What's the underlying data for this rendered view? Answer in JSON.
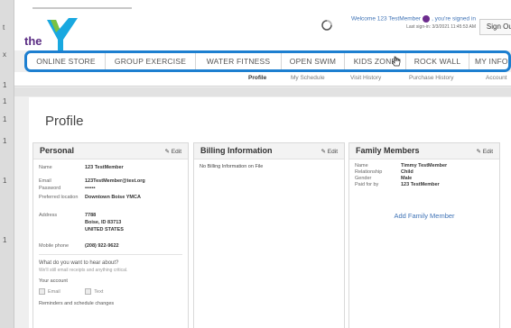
{
  "header": {
    "logo_text": "the",
    "welcome_text": "Welcome 123 TestMember",
    "welcome_suffix": ", you're signed in",
    "last_signin": "Last sign-in: 3/3/2021 11:45:53 AM",
    "sign_out": "Sign Out"
  },
  "nav": {
    "items": [
      {
        "label": "ONLINE STORE"
      },
      {
        "label": "GROUP EXERCISE"
      },
      {
        "label": "WATER FITNESS"
      },
      {
        "label": "OPEN SWIM"
      },
      {
        "label": "KIDS ZONE"
      },
      {
        "label": "ROCK WALL"
      },
      {
        "label": "MY INFO"
      }
    ]
  },
  "subnav": {
    "items": [
      {
        "label": "Profile"
      },
      {
        "label": "My Schedule"
      },
      {
        "label": "Visit History"
      },
      {
        "label": "Purchase History"
      },
      {
        "label": "Account"
      }
    ]
  },
  "page": {
    "title": "Profile"
  },
  "personal": {
    "title": "Personal",
    "edit": "Edit",
    "fields": [
      {
        "label": "Name",
        "value": "123 TestMember"
      },
      {
        "label": "Email",
        "value": "123TestMember@test.org"
      },
      {
        "label": "Password",
        "value": "••••••"
      },
      {
        "label": "Preferred location",
        "value": "Downtown Boise YMCA"
      },
      {
        "label": "Address",
        "value": "7788"
      },
      {
        "label": "",
        "value": "Boise, ID 83713"
      },
      {
        "label": "",
        "value": "UNITED STATES"
      },
      {
        "label": "Mobile phone",
        "value": "(208) 922-9622"
      }
    ],
    "question": "What do you want to hear about?",
    "question_note": "We'll still email receipts and anything critical.",
    "your_account": "Your account",
    "opt_email": "Email",
    "opt_text": "Text",
    "reminders": "Reminders and schedule changes"
  },
  "billing": {
    "title": "Billing Information",
    "edit": "Edit",
    "empty": "No Billing Information on File"
  },
  "family": {
    "title": "Family Members",
    "edit": "Edit",
    "fields": [
      {
        "label": "Name",
        "value": "Timmy TestMember"
      },
      {
        "label": "Relationship",
        "value": "Child"
      },
      {
        "label": "Gender",
        "value": "Male"
      },
      {
        "label": "Paid for by",
        "value": "123 TestMember"
      }
    ],
    "add": "Add Family Member"
  },
  "left_strip": {
    "marks": [
      "t",
      "x",
      "1",
      "1",
      "1",
      "1",
      "1",
      "1"
    ]
  }
}
